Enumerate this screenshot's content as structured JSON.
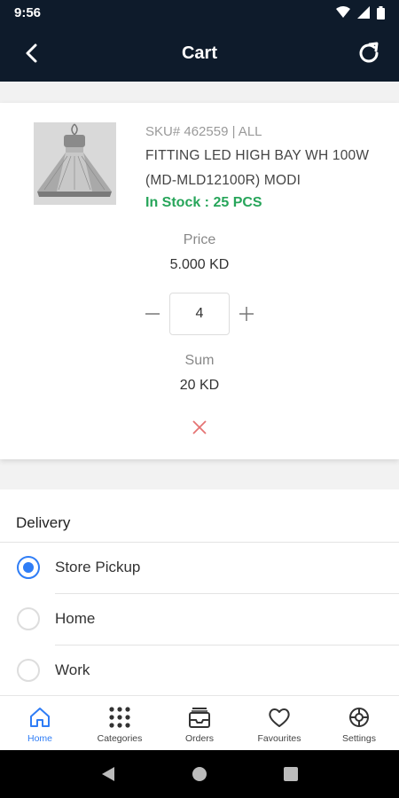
{
  "status_bar": {
    "time": "9:56"
  },
  "app_bar": {
    "title": "Cart"
  },
  "cart_item": {
    "sku": "SKU# 462559 | ALL",
    "name": "FITTING LED HIGH BAY WH 100W (MD-MLD12100R) MODI",
    "stock": "In Stock : 25 PCS",
    "price_label": "Price",
    "price": "5.000 KD",
    "quantity": "4",
    "sum_label": "Sum",
    "sum": "20 KD"
  },
  "delivery": {
    "title": "Delivery",
    "options": [
      {
        "label": "Store Pickup",
        "selected": true
      },
      {
        "label": "Home",
        "selected": false
      },
      {
        "label": "Work",
        "selected": false
      }
    ]
  },
  "tabs": [
    {
      "label": "Home",
      "icon": "home-icon",
      "active": true
    },
    {
      "label": "Categories",
      "icon": "grid-dots-icon",
      "active": false
    },
    {
      "label": "Orders",
      "icon": "inbox-tray-icon",
      "active": false
    },
    {
      "label": "Favourites",
      "icon": "heart-icon",
      "active": false
    },
    {
      "label": "Settings",
      "icon": "gear-icon",
      "active": false
    }
  ],
  "colors": {
    "header": "#0e1b2b",
    "accent": "#2f7df6",
    "in_stock": "#27a55a",
    "remove": "#e57373"
  }
}
